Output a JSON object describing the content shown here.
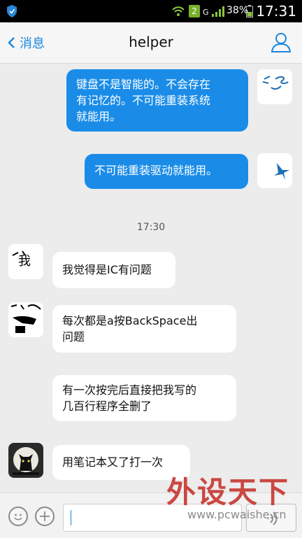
{
  "status_bar": {
    "sim_number": "2",
    "network_type": "G",
    "battery_percent": "38%",
    "time": "17:31"
  },
  "header": {
    "back_label": "消息",
    "title": "helper"
  },
  "messages": [
    {
      "direction": "outgoing",
      "text_lines": [
        "键盘不是智能的。不会存在",
        "有记忆的。不可能重装系统",
        "就能用。"
      ]
    },
    {
      "direction": "outgoing",
      "text_lines": [
        "不可能重装驱动就能用。"
      ]
    },
    {
      "timestamp": "17:30"
    },
    {
      "direction": "incoming",
      "text_lines": [
        "我觉得是IC有问题"
      ]
    },
    {
      "direction": "incoming",
      "text_lines": [
        "每次都是a按BackSpace出",
        "问题"
      ]
    },
    {
      "direction": "incoming",
      "text_lines": [
        "有一次按完后直接把我写的",
        "几百行程序全删了"
      ]
    },
    {
      "direction": "incoming",
      "text_lines": [
        "用笔记本又了打一次"
      ]
    }
  ],
  "composer": {
    "input_value": ""
  },
  "watermark": {
    "brand": "外设天下",
    "url": "www.pcwaishe.cn"
  },
  "icons": {
    "status": [
      "shield-icon",
      "wifi-icon",
      "signal-icon",
      "battery-icon"
    ],
    "header": [
      "chevron-left-icon",
      "profile-icon"
    ],
    "composer": [
      "emoji-icon",
      "plus-icon",
      "voice-icon"
    ]
  },
  "colors": {
    "accent": "#1a87e0",
    "outgoing_bubble": "#1a8ce8",
    "incoming_bubble": "#ffffff",
    "background": "#ececec"
  }
}
